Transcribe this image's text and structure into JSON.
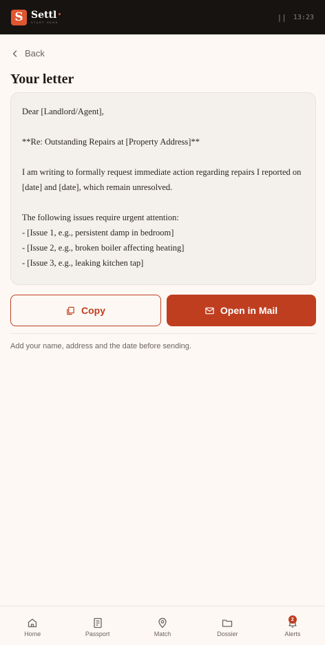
{
  "topbar": {
    "logo_letter": "S",
    "app_name": "Settl",
    "tagline": "START HERE",
    "status_glyph": "||",
    "time": "13:23"
  },
  "back_label": "Back",
  "page_title": "Your letter",
  "letter_text": "Dear [Landlord/Agent],\n\n**Re: Outstanding Repairs at [Property Address]**\n\nI am writing to formally request immediate action regarding repairs I reported on [date] and [date], which remain unresolved.\n\nThe following issues require urgent attention:\n- [Issue 1, e.g., persistent damp in bedroom]\n- [Issue 2, e.g., broken boiler affecting heating]\n- [Issue 3, e.g., leaking kitchen tap]",
  "actions": {
    "copy_label": "Copy",
    "mail_label": "Open in Mail"
  },
  "hint": "Add your name, address and the date before sending.",
  "bottom_nav": {
    "home": "Home",
    "passport": "Passport",
    "match": "Match",
    "dossier": "Dossier",
    "alerts": "Alerts",
    "alerts_badge": "2"
  },
  "colors": {
    "accent": "#bf3e20",
    "logo": "#e0562f",
    "background": "#fdf8f4",
    "topbar": "#161311"
  }
}
